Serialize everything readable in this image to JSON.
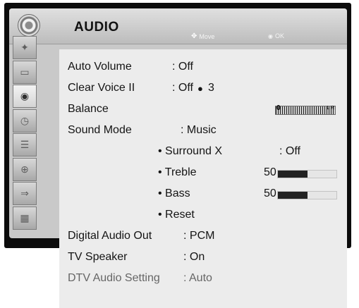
{
  "header": {
    "title": "AUDIO",
    "move_hint": "Move",
    "ok_hint": "OK"
  },
  "sidebar": {
    "items": [
      {
        "icon": "picture-icon"
      },
      {
        "icon": "screen-icon"
      },
      {
        "icon": "audio-icon",
        "selected": true
      },
      {
        "icon": "time-icon"
      },
      {
        "icon": "option-icon"
      },
      {
        "icon": "lock-icon"
      },
      {
        "icon": "input-icon"
      },
      {
        "icon": "media-icon"
      }
    ]
  },
  "settings": {
    "auto_volume": {
      "label": "Auto Volume",
      "value": ": Off"
    },
    "clear_voice": {
      "label": "Clear Voice II",
      "value": ": Off",
      "level": "3"
    },
    "balance": {
      "label": "Balance",
      "left_label": "0",
      "right_label": "L R"
    },
    "sound_mode": {
      "label": "Sound Mode",
      "value": ": Music"
    },
    "surround": {
      "label": "• Surround X",
      "value": ": Off"
    },
    "treble": {
      "label": "• Treble",
      "value": "50",
      "level": 0.5
    },
    "bass": {
      "label": "• Bass",
      "value": "50",
      "level": 0.5
    },
    "reset": {
      "label": "• Reset"
    },
    "digital_audio_out": {
      "label": "Digital Audio Out",
      "value": ": PCM"
    },
    "tv_speaker": {
      "label": "TV Speaker",
      "value": ": On"
    },
    "dtv_audio": {
      "label": "DTV Audio Setting",
      "value": ": Auto"
    }
  }
}
